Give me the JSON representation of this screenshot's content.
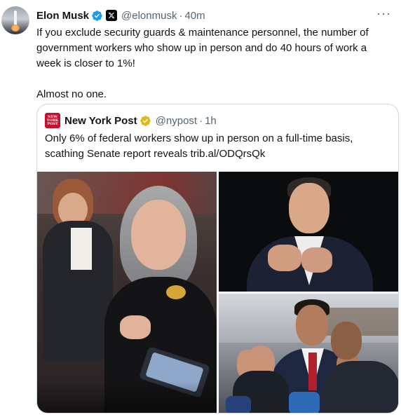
{
  "tweet": {
    "author_name": "Elon Musk",
    "author_handle": "@elonmusk",
    "separator": "·",
    "time": "40m",
    "more": "···",
    "paragraphs": [
      "If you exclude security guards & maintenance personnel, the number of government workers who show up in person and do 40 hours of work a week is closer to 1%!",
      "Almost no one."
    ]
  },
  "quoted": {
    "author_name": "New York Post",
    "author_handle": "@nypost",
    "separator": "·",
    "time": "1h",
    "logo_text": [
      "NEW",
      "YORK",
      "POST"
    ],
    "text": "Only 6% of federal workers show up in person on a full-time basis, scathing Senate report reveals trib.al/ODQrsQk"
  },
  "icons": {
    "verified": "verified-badge-icon",
    "affiliate": "x-affiliate-icon",
    "gold": "gold-verified-icon",
    "more": "more-options-icon"
  },
  "colors": {
    "text": "#0f1419",
    "secondary": "#536471",
    "verified_blue": "#1d9bf0",
    "gold": "#e2b719",
    "nyp_red": "#c8102e",
    "border": "#cfd9de"
  }
}
